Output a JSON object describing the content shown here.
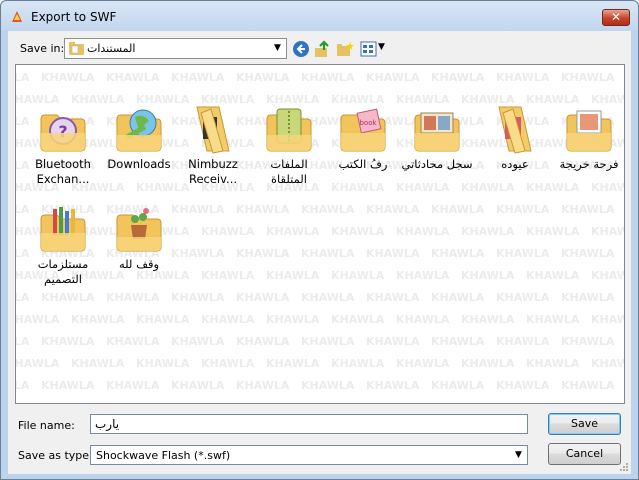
{
  "window": {
    "title": "Export to SWF"
  },
  "toolbar": {
    "save_in_label": "Save in:",
    "save_in_value": "المستندات"
  },
  "watermark": "KHAWLA",
  "items": [
    {
      "label": "Bluetooth\nExchan...",
      "icon": "question-folder-icon"
    },
    {
      "label": "Downloads",
      "icon": "globe-folder-icon"
    },
    {
      "label": "Nimbuzz\nReceiv...",
      "icon": "folder-icon"
    },
    {
      "label": "الملفات المتلقاة",
      "icon": "zipper-folder-icon"
    },
    {
      "label": "رفُ الكتب",
      "icon": "book-folder-icon"
    },
    {
      "label": "سجل محادثاتي",
      "icon": "photos-folder-icon"
    },
    {
      "label": "عيوده",
      "icon": "folder-icon"
    },
    {
      "label": "فرحة خريجة",
      "icon": "picture-folder-icon"
    },
    {
      "label": "مستلزمات\nالتصميم",
      "icon": "pencils-folder-icon"
    },
    {
      "label": "وقف لله",
      "icon": "plant-folder-icon"
    }
  ],
  "footer": {
    "file_name_label": "File name:",
    "file_name_value": "يارب",
    "save_as_type_label": "Save as type:",
    "save_as_type_value": "Shockwave Flash (*.swf)",
    "save_button": "Save",
    "cancel_button": "Cancel"
  }
}
